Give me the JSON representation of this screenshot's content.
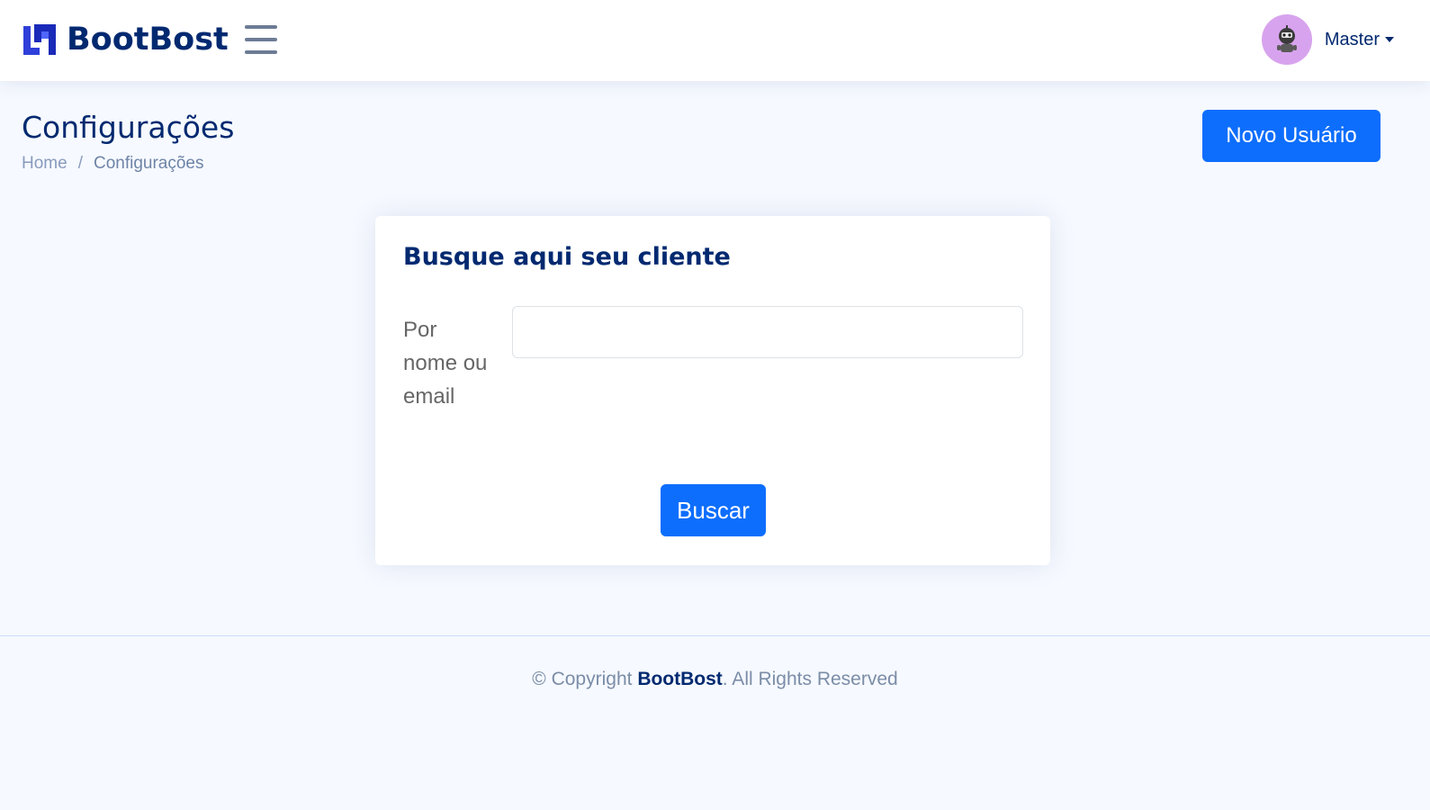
{
  "header": {
    "brand": "BootBost",
    "logo_icon": "bootbost-logo-icon",
    "menu_icon": "hamburger-menu-icon",
    "user": {
      "name": "Master",
      "avatar_icon": "robot-avatar-icon",
      "caret_icon": "caret-down-icon"
    }
  },
  "page": {
    "title": "Configurações",
    "breadcrumb": {
      "home": "Home",
      "separator": "/",
      "current": "Configurações"
    },
    "new_user_button": "Novo Usuário"
  },
  "search_card": {
    "title": "Busque aqui seu cliente",
    "field_label": "Por nome ou email",
    "field_value": "",
    "field_placeholder": "",
    "submit_label": "Buscar"
  },
  "footer": {
    "prefix": "© Copyright",
    "brand": "BootBost",
    "suffix": ". All Rights Reserved"
  },
  "colors": {
    "primary": "#0d6efd",
    "brand_navy": "#012970",
    "background": "#f6f9ff",
    "avatar_bg": "#d8a3ee"
  }
}
